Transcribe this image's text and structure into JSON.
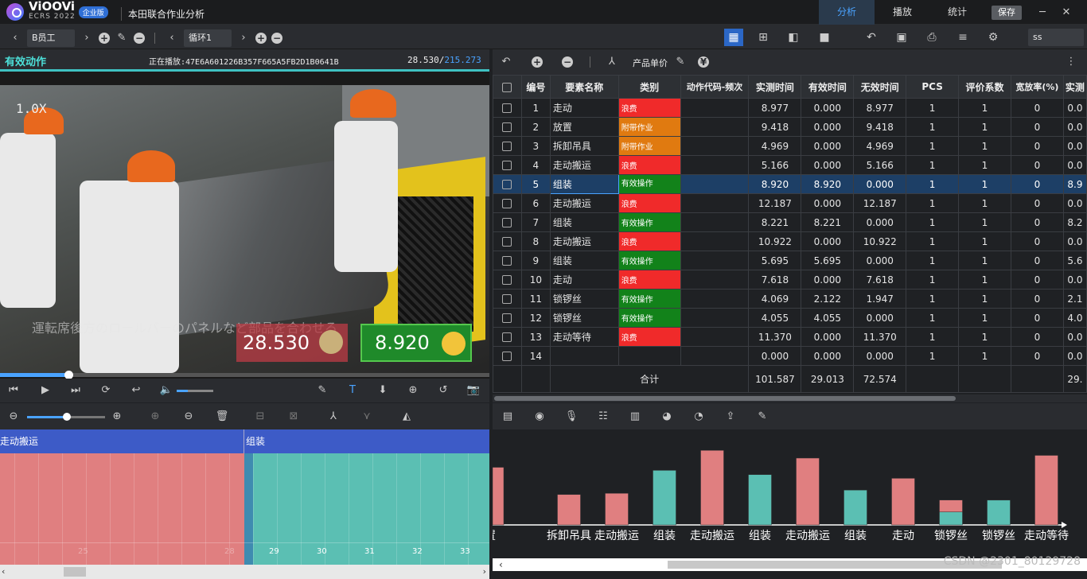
{
  "app": {
    "brand": "ViOOVi",
    "brand_sub": "ECRS 2022",
    "edition_badge": "企业版",
    "title": "本田联合作业分析",
    "tabs": [
      "分析",
      "播放",
      "统计"
    ],
    "save_label": "保存"
  },
  "toolbar2": {
    "worker_select": "B员工",
    "cycle_select": "循环1",
    "user_select": "ss"
  },
  "player": {
    "section_label": "有效动作",
    "now_playing": "正在播放:47E6A601226B357F665A5FB2D1B0641B",
    "time_current": "28.530/",
    "time_total": "215.273",
    "speed": "1.0X",
    "subtitle": "運転席後方のロールバーのパネルなど部品を合わせる",
    "elapsed_value": "28.530",
    "effective_value": "8.920",
    "progress_fraction": 0.14
  },
  "table_toolbar": {
    "unit_price_label": "产品单价"
  },
  "table": {
    "headers": [
      "编号",
      "要素名称",
      "类别",
      "动作代码-频次",
      "实测时间",
      "有效时间",
      "无效时间",
      "PCS",
      "评价系数",
      "宽放率(%)",
      "实测"
    ],
    "rows": [
      {
        "no": "1",
        "name": "走动",
        "cat": "浪费",
        "code": "",
        "measured": "8.977",
        "effective": "0.000",
        "invalid": "8.977",
        "pcs": "1",
        "coef": "1",
        "allow": "0",
        "real": "0.0"
      },
      {
        "no": "2",
        "name": "放置",
        "cat": "附带作业",
        "code": "",
        "measured": "9.418",
        "effective": "0.000",
        "invalid": "9.418",
        "pcs": "1",
        "coef": "1",
        "allow": "0",
        "real": "0.0"
      },
      {
        "no": "3",
        "name": "拆卸吊具",
        "cat": "附带作业",
        "code": "",
        "measured": "4.969",
        "effective": "0.000",
        "invalid": "4.969",
        "pcs": "1",
        "coef": "1",
        "allow": "0",
        "real": "0.0"
      },
      {
        "no": "4",
        "name": "走动搬运",
        "cat": "浪费",
        "code": "",
        "measured": "5.166",
        "effective": "0.000",
        "invalid": "5.166",
        "pcs": "1",
        "coef": "1",
        "allow": "0",
        "real": "0.0"
      },
      {
        "no": "5",
        "name": "组装",
        "cat": "有效操作",
        "code": "",
        "measured": "8.920",
        "effective": "8.920",
        "invalid": "0.000",
        "pcs": "1",
        "coef": "1",
        "allow": "0",
        "real": "8.9"
      },
      {
        "no": "6",
        "name": "走动搬运",
        "cat": "浪费",
        "code": "",
        "measured": "12.187",
        "effective": "0.000",
        "invalid": "12.187",
        "pcs": "1",
        "coef": "1",
        "allow": "0",
        "real": "0.0"
      },
      {
        "no": "7",
        "name": "组装",
        "cat": "有效操作",
        "code": "",
        "measured": "8.221",
        "effective": "8.221",
        "invalid": "0.000",
        "pcs": "1",
        "coef": "1",
        "allow": "0",
        "real": "8.2"
      },
      {
        "no": "8",
        "name": "走动搬运",
        "cat": "浪费",
        "code": "",
        "measured": "10.922",
        "effective": "0.000",
        "invalid": "10.922",
        "pcs": "1",
        "coef": "1",
        "allow": "0",
        "real": "0.0"
      },
      {
        "no": "9",
        "name": "组装",
        "cat": "有效操作",
        "code": "",
        "measured": "5.695",
        "effective": "5.695",
        "invalid": "0.000",
        "pcs": "1",
        "coef": "1",
        "allow": "0",
        "real": "5.6"
      },
      {
        "no": "10",
        "name": "走动",
        "cat": "浪费",
        "code": "",
        "measured": "7.618",
        "effective": "0.000",
        "invalid": "7.618",
        "pcs": "1",
        "coef": "1",
        "allow": "0",
        "real": "0.0"
      },
      {
        "no": "11",
        "name": "锁锣丝",
        "cat": "有效操作",
        "code": "",
        "measured": "4.069",
        "effective": "2.122",
        "invalid": "1.947",
        "pcs": "1",
        "coef": "1",
        "allow": "0",
        "real": "2.1"
      },
      {
        "no": "12",
        "name": "锁锣丝",
        "cat": "有效操作",
        "code": "",
        "measured": "4.055",
        "effective": "4.055",
        "invalid": "0.000",
        "pcs": "1",
        "coef": "1",
        "allow": "0",
        "real": "4.0"
      },
      {
        "no": "13",
        "name": "走动等待",
        "cat": "浪费",
        "code": "",
        "measured": "11.370",
        "effective": "0.000",
        "invalid": "11.370",
        "pcs": "1",
        "coef": "1",
        "allow": "0",
        "real": "0.0"
      },
      {
        "no": "14",
        "name": "",
        "cat": "",
        "code": "",
        "measured": "0.000",
        "effective": "0.000",
        "invalid": "0.000",
        "pcs": "1",
        "coef": "1",
        "allow": "0",
        "real": "0.0"
      }
    ],
    "total": {
      "label": "合计",
      "measured": "101.587",
      "effective": "29.013",
      "invalid": "72.574",
      "real": "29."
    }
  },
  "timeline": {
    "segments": [
      "走动搬运",
      "组装"
    ],
    "ticks": [
      "25",
      "28",
      "29",
      "30",
      "31",
      "32",
      "33"
    ]
  },
  "colors": {
    "waste": "#f02a2a",
    "auxiliary": "#e07a10",
    "effective": "#12821a",
    "bar_waste": "#e07f80",
    "bar_effective": "#5bbfb3"
  },
  "chart_data": {
    "type": "bar",
    "categories": [
      "置",
      "拆卸吊具",
      "走动搬运",
      "组装",
      "走动搬运",
      "组装",
      "走动搬运",
      "组装",
      "走动",
      "锁锣丝",
      "锁锣丝",
      "走动等待"
    ],
    "series": [
      {
        "values": [
          0,
          0,
          0,
          8.92,
          0,
          8.221,
          0,
          5.695,
          0,
          2.122,
          4.055,
          0
        ]
      },
      {
        "values": [
          9.418,
          4.969,
          5.166,
          0,
          12.187,
          0,
          10.922,
          0,
          7.618,
          1.947,
          0,
          11.37
        ]
      }
    ],
    "stacked": true,
    "ylim": [
      0,
      13
    ]
  },
  "watermark": "CSDN @2301_80129728"
}
